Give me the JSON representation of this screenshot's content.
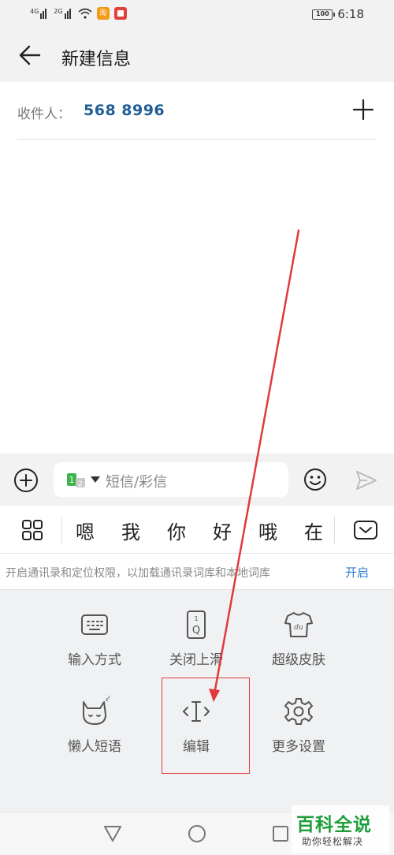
{
  "status_bar": {
    "sim1_tag": "4G",
    "sim2_tag": "2G",
    "app_badge_label": "淘",
    "battery": "100",
    "time": "6:18",
    "icons": [
      "signal-icon",
      "signal-icon",
      "wifi-icon",
      "taobao-app-icon",
      "red-app-icon",
      "battery-icon"
    ]
  },
  "app_bar": {
    "title": "新建信息",
    "back_icon": "back-arrow-icon"
  },
  "recipient": {
    "label": "收件人：",
    "number": "568 8996",
    "add_icon": "plus-icon"
  },
  "compose": {
    "placeholder": "短信/彩信",
    "sim_icon": "dual-sim-icon",
    "attach_icon": "add-circle-icon",
    "emoji_icon": "smiley-icon",
    "send_icon": "send-icon"
  },
  "keyboard": {
    "candidates": [
      "嗯",
      "我",
      "你",
      "好",
      "哦",
      "在"
    ],
    "permission_text": "开启通讯录和定位权限，以加载通讯录词库和本地词库",
    "permission_action": "开启",
    "tiles": [
      {
        "label": "输入方式",
        "icon": "keyboard-icon"
      },
      {
        "label": "关闭上滑",
        "icon": "swipe-toggle-icon"
      },
      {
        "label": "超级皮肤",
        "icon": "tshirt-icon"
      },
      {
        "label": "懒人短语",
        "icon": "sleeping-cat-icon"
      },
      {
        "label": "编辑",
        "icon": "text-cursor-icon"
      },
      {
        "label": "更多设置",
        "icon": "gear-icon"
      }
    ],
    "slide_key_top": "1",
    "slide_key_bottom": "Q",
    "skin_label": "du"
  },
  "watermark": {
    "title": "百科全说",
    "subtitle": "助你轻松解决"
  },
  "colors": {
    "accent_blue": "#2f7dd6",
    "number_blue": "#1f5f96",
    "annotation_red": "#e03a3a",
    "watermark_green": "#1e9e3a"
  }
}
